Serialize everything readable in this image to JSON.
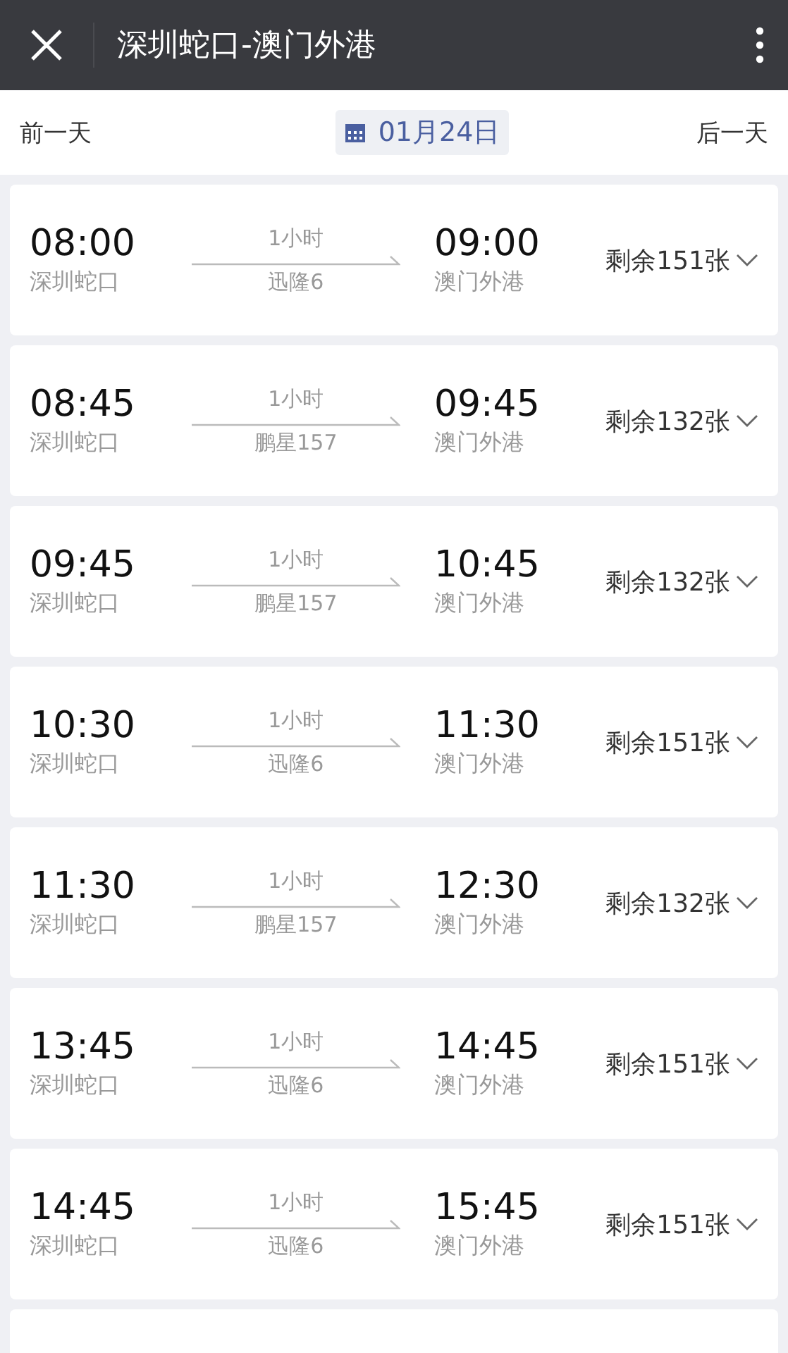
{
  "header": {
    "title": "深圳蛇口-澳门外港"
  },
  "date_bar": {
    "prev": "前一天",
    "date": "01月24日",
    "next": "后一天"
  },
  "trips": [
    {
      "depart_time": "08:00",
      "depart_port": "深圳蛇口",
      "duration": "1小时",
      "vessel": "迅隆6",
      "arrive_time": "09:00",
      "arrive_port": "澳门外港",
      "remaining": "剩余151张"
    },
    {
      "depart_time": "08:45",
      "depart_port": "深圳蛇口",
      "duration": "1小时",
      "vessel": "鹏星157",
      "arrive_time": "09:45",
      "arrive_port": "澳门外港",
      "remaining": "剩余132张"
    },
    {
      "depart_time": "09:45",
      "depart_port": "深圳蛇口",
      "duration": "1小时",
      "vessel": "鹏星157",
      "arrive_time": "10:45",
      "arrive_port": "澳门外港",
      "remaining": "剩余132张"
    },
    {
      "depart_time": "10:30",
      "depart_port": "深圳蛇口",
      "duration": "1小时",
      "vessel": "迅隆6",
      "arrive_time": "11:30",
      "arrive_port": "澳门外港",
      "remaining": "剩余151张"
    },
    {
      "depart_time": "11:30",
      "depart_port": "深圳蛇口",
      "duration": "1小时",
      "vessel": "鹏星157",
      "arrive_time": "12:30",
      "arrive_port": "澳门外港",
      "remaining": "剩余132张"
    },
    {
      "depart_time": "13:45",
      "depart_port": "深圳蛇口",
      "duration": "1小时",
      "vessel": "迅隆6",
      "arrive_time": "14:45",
      "arrive_port": "澳门外港",
      "remaining": "剩余151张"
    },
    {
      "depart_time": "14:45",
      "depart_port": "深圳蛇口",
      "duration": "1小时",
      "vessel": "迅隆6",
      "arrive_time": "15:45",
      "arrive_port": "澳门外港",
      "remaining": "剩余151张"
    }
  ]
}
